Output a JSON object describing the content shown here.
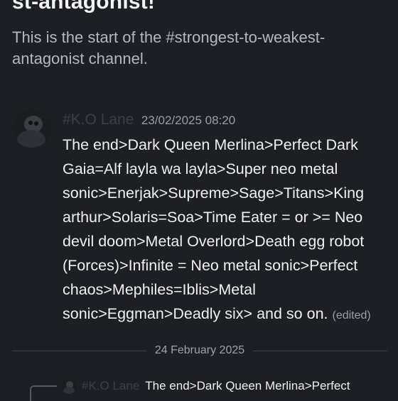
{
  "channel": {
    "heading": "st-antagonist!",
    "intro": "This is the start of the #strongest-to-weakest-antagonist channel."
  },
  "message": {
    "avatar_icon": "user-avatar-icon",
    "author": "#K.O Lane",
    "timestamp": "23/02/2025 08:20",
    "text": "The end>Dark Queen Merlina>Perfect Dark Gaia=Alf layla wa layla>Super neo metal sonic>Enerjak>Supreme>Sage>Titans>King arthur>Solaris=Soa>Time Eater = or >= Neo devil doom>Metal Overlord>Death egg robot (Forces)>Infinite = Neo metal sonic>Perfect chaos>Mephiles=Iblis>Metal sonic>Eggman>Deadly six> and so on.",
    "edited": "(edited)"
  },
  "date_divider": {
    "label": "24 February 2025"
  },
  "reply": {
    "avatar_icon": "user-avatar-icon",
    "author": "#K.O Lane",
    "text": "The end>Dark Queen Merlina>Perfect"
  },
  "colors": {
    "background": "#1e1f24",
    "author_name": "#3b3e45",
    "text": "#eef0f2",
    "muted": "#9a9ea6"
  }
}
